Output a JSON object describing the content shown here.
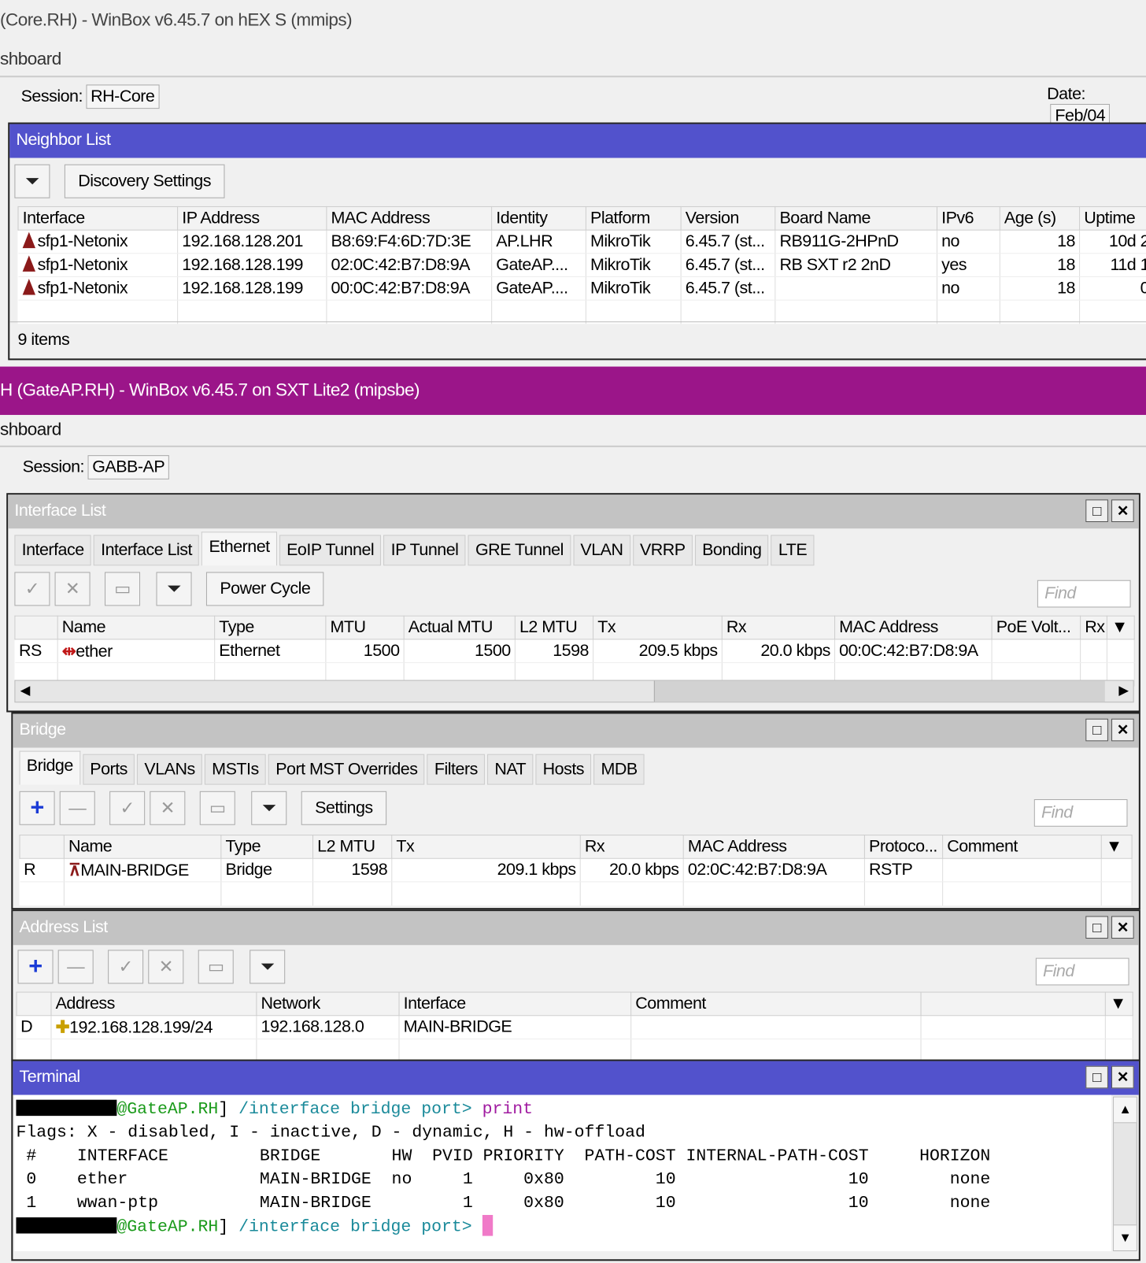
{
  "window1": {
    "title": "(Core.RH) - WinBox v6.45.7 on hEX S (mmips)",
    "menu": "shboard",
    "session_label": "Session:",
    "session_value": "RH-Core",
    "date_label": "Date:",
    "date_value": "Feb/04"
  },
  "neighbor": {
    "title": "Neighbor List",
    "discovery_button": "Discovery Settings",
    "columns": [
      "Interface",
      "IP Address",
      "MAC Address",
      "Identity",
      "Platform",
      "Version",
      "Board Name",
      "IPv6",
      "Age (s)",
      "Uptime"
    ],
    "rows": [
      [
        "sfp1-Netonix",
        "192.168.128.201",
        "B8:69:F4:6D:7D:3E",
        "AP.LHR",
        "MikroTik",
        "6.45.7 (st...",
        "RB911G-2HPnD",
        "no",
        "18",
        "10d 2"
      ],
      [
        "sfp1-Netonix",
        "192.168.128.199",
        "02:0C:42:B7:D8:9A",
        "GateAP....",
        "MikroTik",
        "6.45.7 (st...",
        "RB SXT r2 2nD",
        "yes",
        "18",
        "11d 1"
      ],
      [
        "sfp1-Netonix",
        "192.168.128.199",
        "00:0C:42:B7:D8:9A",
        "GateAP....",
        "MikroTik",
        "6.45.7 (st...",
        "",
        "no",
        "18",
        "0"
      ]
    ],
    "footer": "9 items"
  },
  "window2": {
    "title": "H (GateAP.RH) - WinBox v6.45.7 on SXT Lite2 (mipsbe)",
    "menu": "shboard",
    "session_label": "Session:",
    "session_value": "GABB-AP",
    "color": "#9b1589"
  },
  "iflist": {
    "title": "Interface List",
    "tabs": [
      "Interface",
      "Interface List",
      "Ethernet",
      "EoIP Tunnel",
      "IP Tunnel",
      "GRE Tunnel",
      "VLAN",
      "VRRP",
      "Bonding",
      "LTE"
    ],
    "active_tab": "Ethernet",
    "power_cycle": "Power Cycle",
    "find": "Find",
    "columns": [
      "",
      "Name",
      "Type",
      "MTU",
      "Actual MTU",
      "L2 MTU",
      "Tx",
      "Rx",
      "MAC Address",
      "PoE Volt...",
      "Rx",
      "▼"
    ],
    "rows": [
      [
        "RS",
        "ether",
        "Ethernet",
        "1500",
        "1500",
        "1598",
        "209.5 kbps",
        "20.0 kbps",
        "00:0C:42:B7:D8:9A",
        "",
        "",
        ""
      ]
    ]
  },
  "bridge": {
    "title": "Bridge",
    "tabs": [
      "Bridge",
      "Ports",
      "VLANs",
      "MSTIs",
      "Port MST Overrides",
      "Filters",
      "NAT",
      "Hosts",
      "MDB"
    ],
    "active_tab": "Bridge",
    "settings": "Settings",
    "find": "Find",
    "columns": [
      "",
      "Name",
      "Type",
      "L2 MTU",
      "Tx",
      "Rx",
      "MAC Address",
      "Protoco...",
      "Comment",
      "▼"
    ],
    "rows": [
      [
        "R",
        "MAIN-BRIDGE",
        "Bridge",
        "1598",
        "209.1 kbps",
        "20.0 kbps",
        "02:0C:42:B7:D8:9A",
        "RSTP",
        "",
        ""
      ]
    ]
  },
  "address": {
    "title": "Address List",
    "find": "Find",
    "columns": [
      "",
      "Address",
      "Network",
      "Interface",
      "Comment",
      "",
      "▼"
    ],
    "rows": [
      [
        "D",
        "192.168.128.199/24",
        "192.168.128.0",
        "MAIN-BRIDGE",
        "",
        "",
        ""
      ]
    ]
  },
  "terminal": {
    "title": "Terminal",
    "host": "@GateAP.RH",
    "bracket": "]",
    "path": " /interface bridge port>",
    "cmd": " print",
    "lines": [
      "Flags: X - disabled, I - inactive, D - dynamic, H - hw-offload",
      " #    INTERFACE         BRIDGE       HW  PVID PRIORITY  PATH-COST INTERNAL-PATH-COST     HORIZON",
      " 0    ether             MAIN-BRIDGE  no     1     0x80         10                 10        none",
      " 1    wwan-ptp          MAIN-BRIDGE         1     0x80         10                 10        none"
    ]
  }
}
